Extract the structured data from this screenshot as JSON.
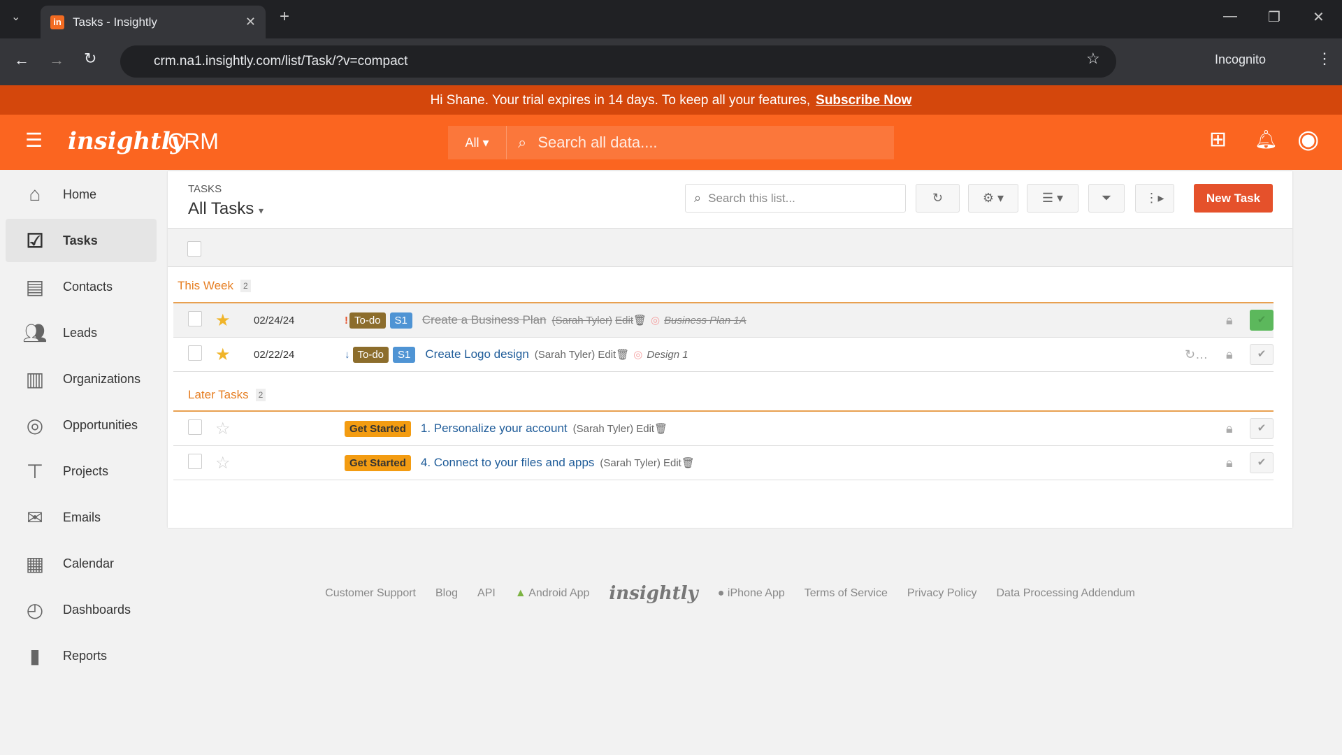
{
  "browser": {
    "tab_title": "Tasks - Insightly",
    "url": "crm.na1.insightly.com/list/Task/?v=compact",
    "incognito": "Incognito"
  },
  "banner": {
    "text": "Hi Shane. Your trial expires in 14 days. To keep all your features,",
    "link": "Subscribe Now"
  },
  "header": {
    "logo": "insightly",
    "product": "CRM",
    "search_scope": "All",
    "search_placeholder": "Search all data...."
  },
  "sidebar": {
    "items": [
      {
        "label": "Home",
        "icon": "home-icon"
      },
      {
        "label": "Tasks",
        "icon": "tasks-icon"
      },
      {
        "label": "Contacts",
        "icon": "contacts-icon"
      },
      {
        "label": "Leads",
        "icon": "leads-icon"
      },
      {
        "label": "Organizations",
        "icon": "organizations-icon"
      },
      {
        "label": "Opportunities",
        "icon": "target-icon"
      },
      {
        "label": "Projects",
        "icon": "projects-icon"
      },
      {
        "label": "Emails",
        "icon": "envelope-icon"
      },
      {
        "label": "Calendar",
        "icon": "calendar-icon"
      },
      {
        "label": "Dashboards",
        "icon": "dashboard-icon"
      },
      {
        "label": "Reports",
        "icon": "bar-chart-icon"
      }
    ]
  },
  "list": {
    "section": "TASKS",
    "view": "All Tasks",
    "search_placeholder": "Search this list...",
    "new_task": "New Task",
    "groups": [
      {
        "name": "This Week",
        "count": "2",
        "tasks": [
          {
            "date": "02/24/24",
            "priority": "!",
            "status": "To-do",
            "tag": "S1",
            "title": "Create a Business Plan",
            "owner": "(Sarah Tyler)",
            "edit": "Edit",
            "related": "Business Plan 1A",
            "starred": true,
            "completed": true
          },
          {
            "date": "02/22/24",
            "priority": "↓",
            "status": "To-do",
            "tag": "S1",
            "title": "Create Logo design",
            "owner": "(Sarah Tyler)",
            "edit": "Edit",
            "related": "Design 1",
            "starred": true,
            "completed": false,
            "recurring": "…"
          }
        ]
      },
      {
        "name": "Later Tasks",
        "count": "2",
        "tasks": [
          {
            "status": "Get Started",
            "title": "1. Personalize your account",
            "owner": "(Sarah Tyler)",
            "edit": "Edit",
            "starred": false,
            "completed": false
          },
          {
            "status": "Get Started",
            "title": "4. Connect to your files and apps",
            "owner": "(Sarah Tyler)",
            "edit": "Edit",
            "starred": false,
            "completed": false
          }
        ]
      }
    ]
  },
  "footer": {
    "links": [
      "Customer Support",
      "Blog",
      "API",
      "Android App",
      "iPhone App",
      "Terms of Service",
      "Privacy Policy",
      "Data Processing Addendum"
    ],
    "logo": "insightly"
  }
}
